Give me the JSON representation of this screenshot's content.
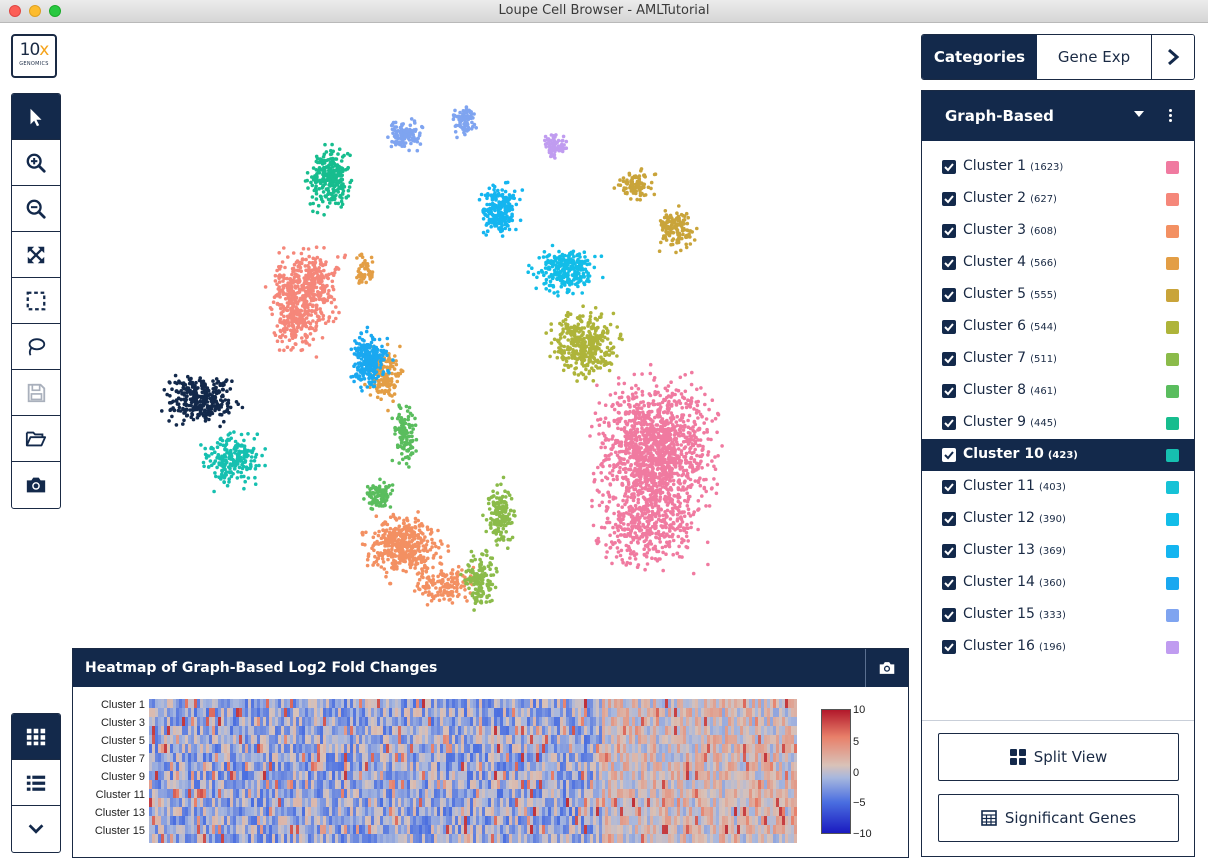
{
  "window": {
    "title": "Loupe Cell Browser - AMLTutorial"
  },
  "logo": {
    "line1_a": "10",
    "line1_b": "x",
    "line2": "GENOMICS"
  },
  "toolbar": {
    "tools": [
      "select-pointer",
      "zoom-in",
      "zoom-out",
      "fit-to-screen",
      "box-select",
      "lasso-select",
      "save",
      "open-folder",
      "screenshot"
    ]
  },
  "bottom_toolbar": {
    "tools": [
      "grid-view",
      "list-view",
      "collapse"
    ]
  },
  "right_tabs": {
    "categories": "Categories",
    "gene_exp": "Gene Exp"
  },
  "category_panel": {
    "title": "Graph-Based",
    "clusters": [
      {
        "name": "Cluster 1",
        "count": "(1623)",
        "color": "#f07aa0",
        "selected": false
      },
      {
        "name": "Cluster 2",
        "count": "(627)",
        "color": "#f5877a",
        "selected": false
      },
      {
        "name": "Cluster 3",
        "count": "(608)",
        "color": "#f39062",
        "selected": false
      },
      {
        "name": "Cluster 4",
        "count": "(566)",
        "color": "#e39e45",
        "selected": false
      },
      {
        "name": "Cluster 5",
        "count": "(555)",
        "color": "#c9a43a",
        "selected": false
      },
      {
        "name": "Cluster 6",
        "count": "(544)",
        "color": "#aeb43a",
        "selected": false
      },
      {
        "name": "Cluster 7",
        "count": "(511)",
        "color": "#8bbb4a",
        "selected": false
      },
      {
        "name": "Cluster 8",
        "count": "(461)",
        "color": "#5abd5e",
        "selected": false
      },
      {
        "name": "Cluster 9",
        "count": "(445)",
        "color": "#17bd8e",
        "selected": false
      },
      {
        "name": "Cluster 10",
        "count": "(423)",
        "color": "#16c0b0",
        "selected": true
      },
      {
        "name": "Cluster 11",
        "count": "(403)",
        "color": "#17c2d6",
        "selected": false
      },
      {
        "name": "Cluster 12",
        "count": "(390)",
        "color": "#12bde8",
        "selected": false
      },
      {
        "name": "Cluster 13",
        "count": "(369)",
        "color": "#14b5f0",
        "selected": false
      },
      {
        "name": "Cluster 14",
        "count": "(360)",
        "color": "#1aa8f0",
        "selected": false
      },
      {
        "name": "Cluster 15",
        "count": "(333)",
        "color": "#7fa4f0",
        "selected": false
      },
      {
        "name": "Cluster 16",
        "count": "(196)",
        "color": "#c09cf0",
        "selected": false
      }
    ],
    "split_view_label": "Split View",
    "significant_genes_label": "Significant Genes"
  },
  "heatmap": {
    "title": "Heatmap of Graph-Based Log2 Fold Changes",
    "row_labels": [
      "Cluster 1",
      "Cluster 3",
      "Cluster 5",
      "Cluster 7",
      "Cluster 9",
      "Cluster 11",
      "Cluster 13",
      "Cluster 15"
    ],
    "colorbar_ticks": [
      "10",
      "5",
      "0",
      "−5",
      "−10"
    ],
    "colorbar_range": [
      -10,
      10
    ]
  }
}
